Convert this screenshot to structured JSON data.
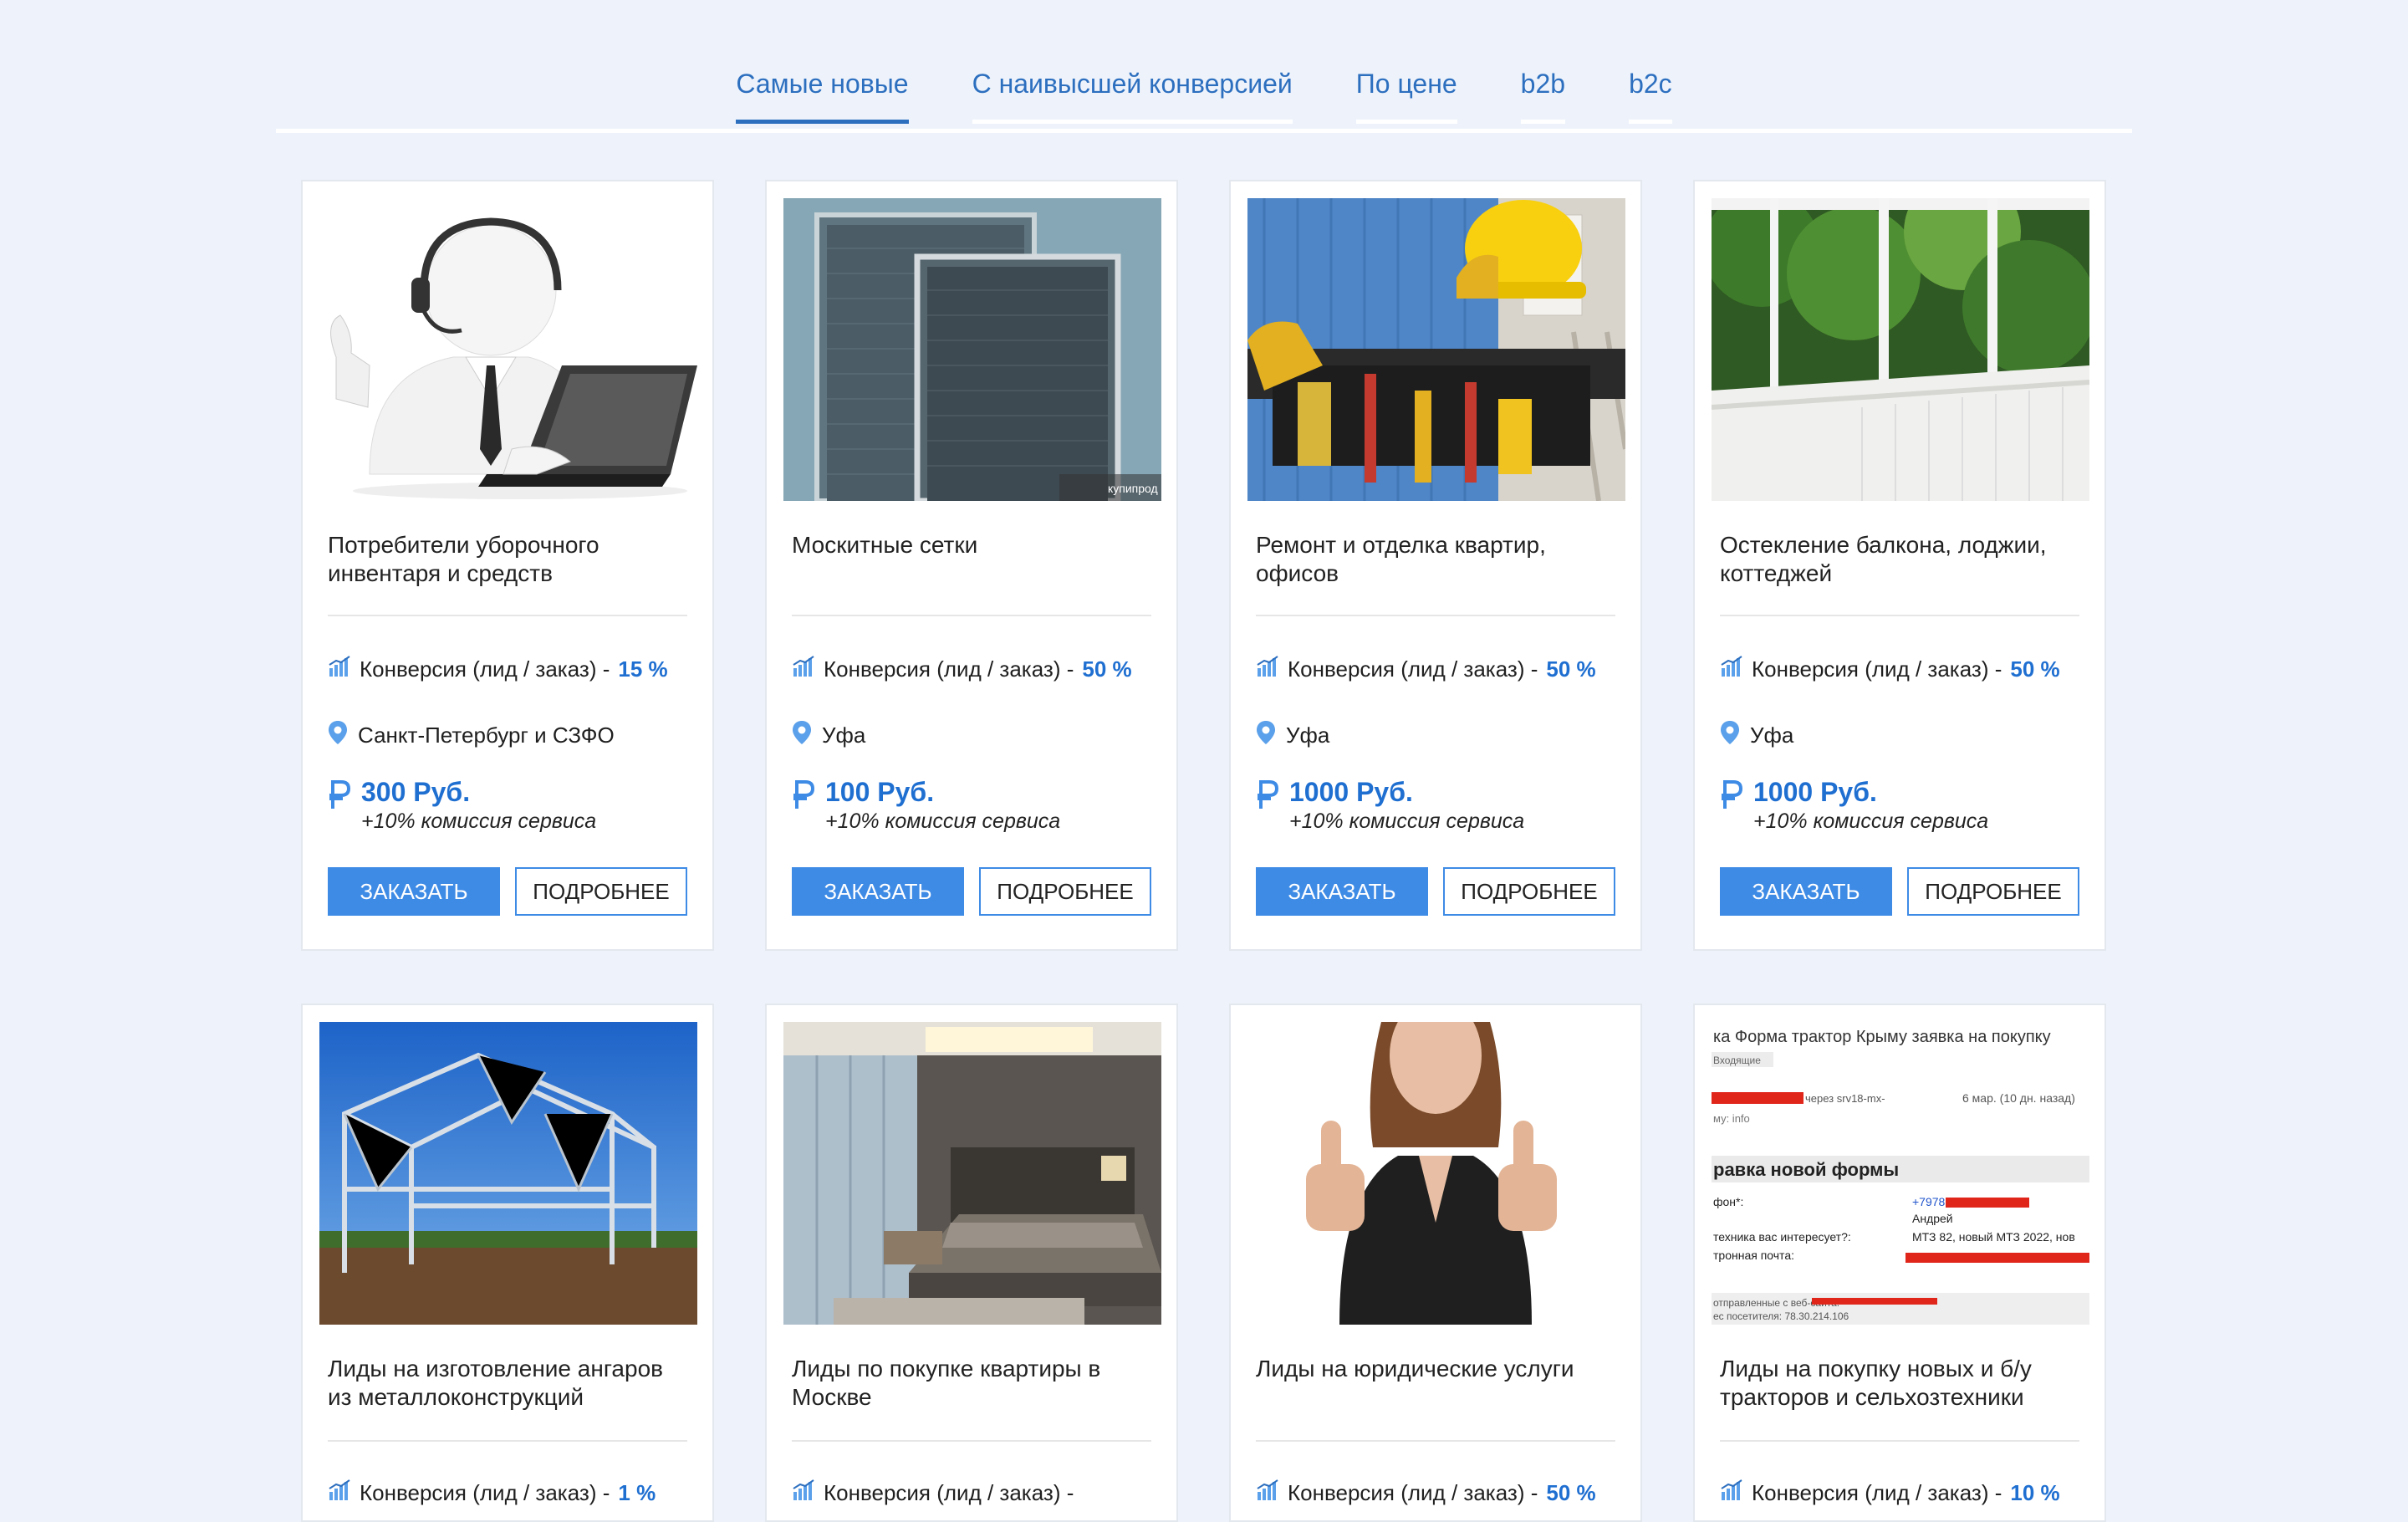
{
  "tabs": [
    {
      "label": "Самые новые",
      "active": true
    },
    {
      "label": "С наивысшей конверсией",
      "active": false
    },
    {
      "label": "По цене",
      "active": false
    },
    {
      "label": "b2b",
      "active": false
    },
    {
      "label": "b2c",
      "active": false
    }
  ],
  "cards": [
    {
      "title": "Потребители уборочного инвентаря и средств",
      "conversion_label": "Конверсия (лид / заказ) -",
      "conversion_value": "15 %",
      "location": "Санкт-Петербург и СЗФО",
      "price": "300 Руб.",
      "fee": "+10% комиссия сервиса",
      "order_label": "ЗАКАЗАТЬ",
      "more_label": "ПОДРОБНЕЕ",
      "image": "support-person-laptop"
    },
    {
      "title": "Москитные сетки",
      "conversion_label": "Конверсия (лид / заказ) -",
      "conversion_value": "50 %",
      "location": "Уфа",
      "price": "100 Руб.",
      "fee": "+10% комиссия сервиса",
      "order_label": "ЗАКАЗАТЬ",
      "more_label": "ПОДРОБНЕЕ",
      "image": "mosquito-nets",
      "image_caption": "купипрод"
    },
    {
      "title": "Ремонт и отделка квартир, офисов",
      "conversion_label": "Конверсия (лид / заказ) -",
      "conversion_value": "50 %",
      "location": "Уфа",
      "price": "1000 Руб.",
      "fee": "+10% комиссия сервиса",
      "order_label": "ЗАКАЗАТЬ",
      "more_label": "ПОДРОБНЕЕ",
      "image": "worker-helmet-tools"
    },
    {
      "title": "Остекление балкона, лоджии, коттеджей",
      "conversion_label": "Конверсия (лид / заказ) -",
      "conversion_value": "50 %",
      "location": "Уфа",
      "price": "1000 Руб.",
      "fee": "+10% комиссия сервиса",
      "order_label": "ЗАКАЗАТЬ",
      "more_label": "ПОДРОБНЕЕ",
      "image": "balcony-glazing"
    },
    {
      "title": "Лиды на изготовление ангаров из металлоконструкций",
      "conversion_label": "Конверсия (лид / заказ) -",
      "conversion_value": "1 %",
      "image": "steel-frame-hangar"
    },
    {
      "title": "Лиды по покупке квартиры в Москве",
      "conversion_label": "Конверсия (лид / заказ) -",
      "conversion_value": "",
      "image": "bedroom-apartment"
    },
    {
      "title": "Лиды на юридические услуги",
      "conversion_label": "Конверсия (лид / заказ) -",
      "conversion_value": "50 %",
      "image": "woman-thumbs-up"
    },
    {
      "title": "Лиды на покупку новых и б/у тракторов и сельхозтехники",
      "conversion_label": "Конверсия (лид / заказ) -",
      "conversion_value": "10 %",
      "image": "email-form-screenshot",
      "email_shot": {
        "subject": "ка Форма трактор Крыму заявка на покупку",
        "inbox": "Входящие",
        "via": "через srv18-mx-",
        "date": "6 мар. (10 дн. назад)",
        "to": "му: info",
        "heading": "равка новой формы",
        "phone_label": "фон*:",
        "phone_value": "+7978",
        "name_value": "Андрей",
        "tech_label": "техника вас интересует?:",
        "tech_value": "МТЗ 82, новый МТЗ 2022, нов",
        "mail_label": "тронная почта:",
        "sent_label": "отправленные с веб-сайта:",
        "ip_label": "ес посетителя: 78.30.214.106"
      }
    }
  ],
  "colors": {
    "accent": "#1f6fd1",
    "button": "#3e8be6",
    "bg": "#eef3fb"
  }
}
